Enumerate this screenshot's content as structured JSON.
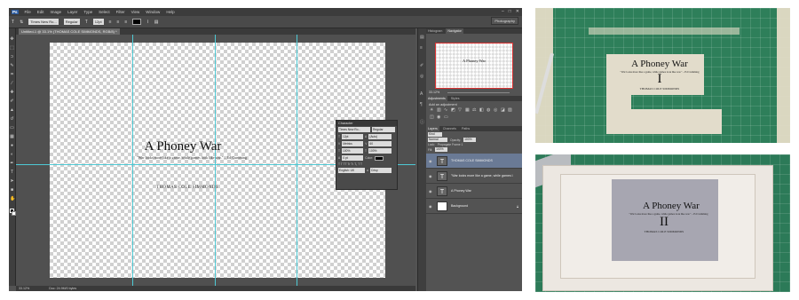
{
  "app": {
    "logo": "Ps",
    "menus": [
      "File",
      "Edit",
      "Image",
      "Layer",
      "Type",
      "Select",
      "Filter",
      "View",
      "Window",
      "Help"
    ],
    "window_controls": [
      "–",
      "□",
      "✕"
    ],
    "workspace": "Photography"
  },
  "options_bar": {
    "font_family": "Times New Ro...",
    "font_style": "Regular",
    "font_size": "12pt"
  },
  "document": {
    "tab": "Untitled-1 @ 33.1% (THOMAS COLE SIMMONDS, RGB/8) *",
    "title": "A Phoney War",
    "quote": "\"War looks more like a game, while games look like war.\" – Ed Cumming",
    "author": "THOMAS COLE SIMMONDS"
  },
  "status_bar": {
    "zoom": "33.12%",
    "doc_size": "Doc: 24.9M/0 bytes"
  },
  "character_panel": {
    "header": "Character",
    "font_family": "Times New Ro...",
    "font_style": "Regular",
    "size": "12pt",
    "leading": "(Auto)",
    "kerning": "Metrics",
    "tracking": "60",
    "vscale": "100%",
    "hscale": "100%",
    "baseline": "0 pt",
    "color_label": "Color:",
    "language": "English: UK",
    "aa": "Crisp"
  },
  "navigator": {
    "tabs": [
      "Histogram",
      "Navigator"
    ],
    "thumb_title": "A Phoney War",
    "zoom": "33.12%"
  },
  "adjustments": {
    "tabs": [
      "Adjustments",
      "Styles"
    ],
    "heading": "Add an adjustment"
  },
  "layers_panel": {
    "tabs": [
      "Layers",
      "Channels",
      "Paths"
    ],
    "kind": "Kind",
    "blend": "Normal",
    "opacity_label": "Opacity:",
    "opacity": "100%",
    "lock_label": "Lock:",
    "propagate": "Propagate Frame 1",
    "fill_label": "Fill:",
    "fill": "100%",
    "layers": [
      {
        "name": "THOMAS COLE SIMMONDS",
        "thumb": "T",
        "selected": true
      },
      {
        "name": "\"War looks more like a game, while games l...",
        "thumb": "T",
        "selected": false
      },
      {
        "name": "A Phoney War",
        "thumb": "T",
        "selected": false
      },
      {
        "name": "Background",
        "thumb": "",
        "selected": false
      }
    ]
  },
  "photo1": {
    "title": "A Phoney War",
    "quote": "\"War looks more like a game, while games look like war.\" – Ed Cumming",
    "numeral": "I",
    "author": "THOMAS COLE SIMMONDS"
  },
  "photo2": {
    "title": "A Phoney War",
    "quote": "\"War looks more like a game, while games look like war.\" – Ed Cumming",
    "numeral": "II",
    "author": "THOMAS COLE SIMMONDS"
  },
  "colors": {
    "ps_bg": "#535353",
    "guide": "#4ec9d4",
    "cutting_mat": "#2e7f5a",
    "tape": "#e4dcc6",
    "selected_layer": "#6a7a95"
  }
}
